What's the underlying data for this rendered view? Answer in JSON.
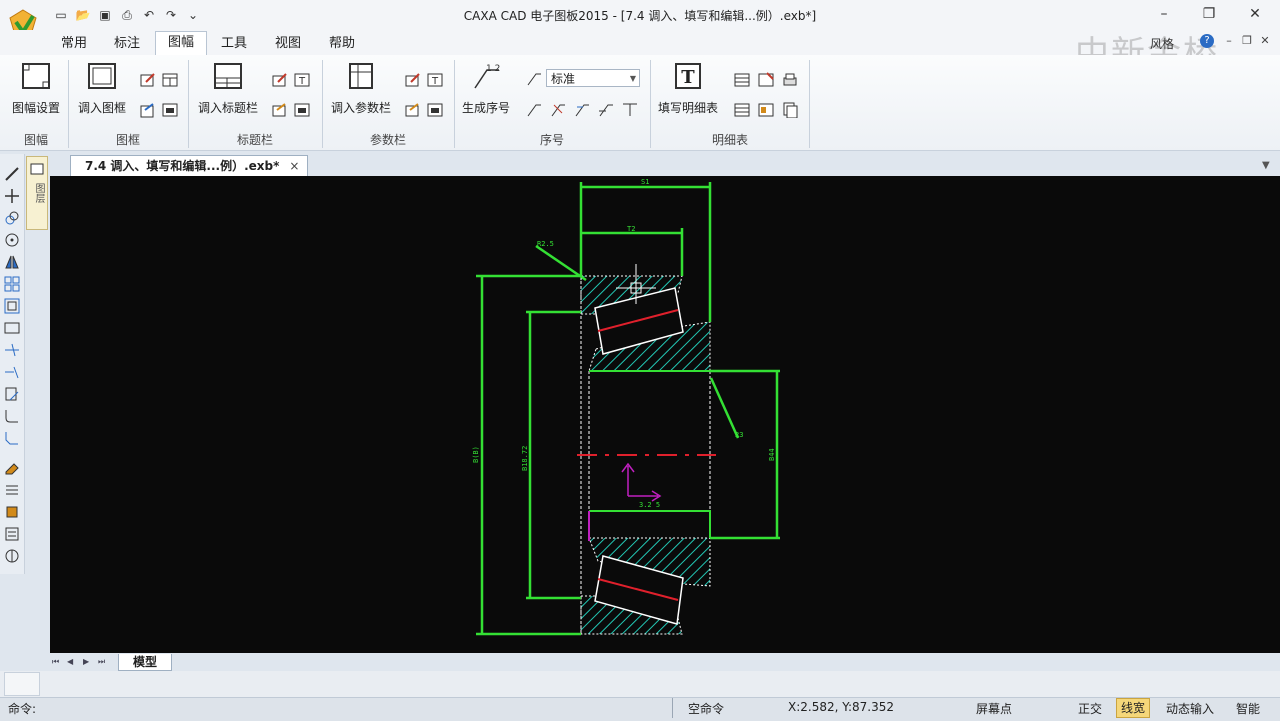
{
  "title_bar": {
    "title": "CAXA CAD 电子图板2015 - [7.4 调入、填写和编辑...例）.exb*]"
  },
  "quick_access": {
    "icons": [
      "new-file-icon",
      "open-file-icon",
      "save-icon",
      "print-icon",
      "undo-icon",
      "redo-icon",
      "customize-icon"
    ]
  },
  "ribbon_tabs": [
    "常用",
    "标注",
    "图幅",
    "工具",
    "视图",
    "帮助"
  ],
  "active_tab": "图幅",
  "ribbon_right": {
    "style_label": "风格",
    "watermark": "中新金桥"
  },
  "ribbon": {
    "groups": [
      {
        "label": "图幅",
        "big_buttons": [
          "图幅设置"
        ]
      },
      {
        "label": "图框",
        "big_buttons": [
          "调入图框"
        ]
      },
      {
        "label": "标题栏",
        "big_buttons": [
          "调入标题栏"
        ]
      },
      {
        "label": "参数栏",
        "big_buttons": [
          "调入参数栏"
        ]
      },
      {
        "label": "序号",
        "big_buttons": [
          "生成序号"
        ],
        "select_value": "标准"
      },
      {
        "label": "明细表",
        "big_buttons": [
          "填写明细表"
        ]
      }
    ],
    "icon_glyphs": {
      "balloon": "1 2",
      "table_text": "T"
    }
  },
  "document": {
    "tab_label": "7.4 调入、填写和编辑...例）.exb*",
    "layer_panel_label": "图层"
  },
  "sheet_tabs": [
    "模型"
  ],
  "status_bar": {
    "command_label": "命令:",
    "command_state": "空命令",
    "coords": "X:2.582, Y:87.352",
    "snap_mode": "屏幕点",
    "toggles": [
      "正交",
      "线宽",
      "动态输入",
      "智能"
    ],
    "active_toggle": "线宽"
  },
  "drawing": {
    "colors": {
      "background": "#0a0a0a",
      "outline": "#34e034",
      "hatch": "#22c7b4",
      "centerline": "#e0202c",
      "ucs": "#c020c0",
      "part_edge": "#ffffff"
    },
    "dim_labels": [
      "S1",
      "T2",
      "R2.5",
      "R3",
      "B(B)",
      "B18.72",
      "B44",
      "3.2 5"
    ]
  }
}
